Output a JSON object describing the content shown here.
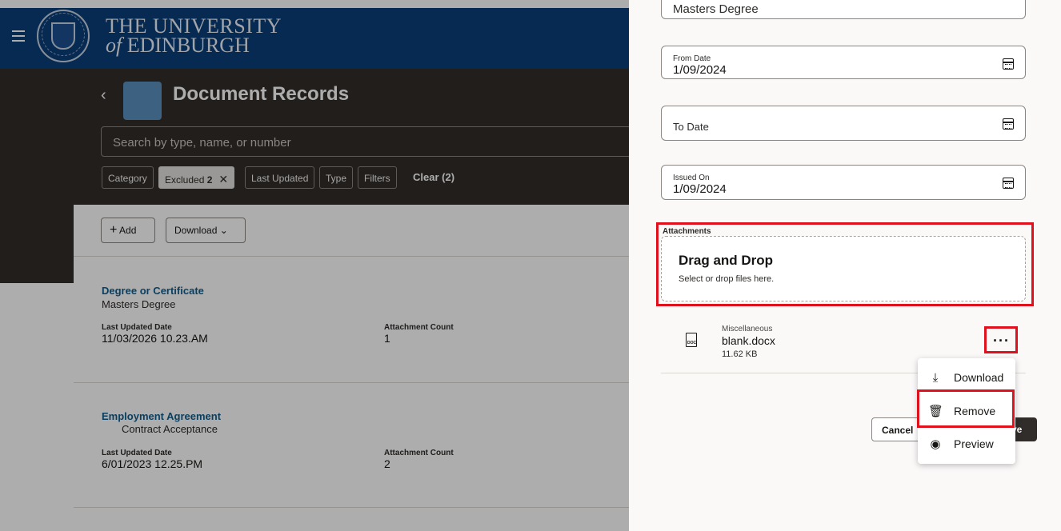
{
  "header": {
    "university_line1": "THE UNIVERSITY",
    "university_line2_prefix": "of",
    "university_line2": "EDINBURGH"
  },
  "page": {
    "title": "Document Records",
    "search_placeholder": "Search by type, name, or number",
    "filters": [
      {
        "label": "Category"
      },
      {
        "label": "Excluded",
        "count": "2",
        "selected": true
      },
      {
        "label": "Last Updated"
      },
      {
        "label": "Type"
      },
      {
        "label": "Filters"
      }
    ],
    "clear_label": "Clear (2)",
    "add_label": "Add",
    "download_label": "Download"
  },
  "records": [
    {
      "title": "Degree or Certificate",
      "subtitle": "Masters Degree",
      "updated_label": "Last Updated Date",
      "updated_value": "11/03/2026 10.23.AM",
      "count_label": "Attachment Count",
      "count_value": "1"
    },
    {
      "title": "Employment Agreement",
      "subtitle": "Contract Acceptance",
      "updated_label": "Last Updated Date",
      "updated_value": "6/01/2023 12.25.PM",
      "count_label": "Attachment Count",
      "count_value": "2"
    }
  ],
  "drawer": {
    "top_field_value": "Masters Degree",
    "from_date": {
      "label": "From Date",
      "value": "1/09/2024"
    },
    "to_date": {
      "label": "To Date",
      "value": ""
    },
    "issued_on": {
      "label": "Issued On",
      "value": "1/09/2024"
    },
    "attachments_label": "Attachments",
    "dropzone_title": "Drag and Drop",
    "dropzone_sub": "Select or drop files here.",
    "file": {
      "category": "Miscellaneous",
      "name": "blank.docx",
      "size": "11.62 KB",
      "icon_text": "DOC"
    },
    "kebab": "···",
    "cancel_label": "Cancel",
    "save_label_visible": "ve"
  },
  "context_menu": [
    {
      "label": "Download",
      "icon": "download-icon"
    },
    {
      "label": "Remove",
      "icon": "trash-icon"
    },
    {
      "label": "Preview",
      "icon": "eye-icon"
    }
  ],
  "colors": {
    "brand_blue": "#0a3f7a",
    "dark_band": "#312d2a",
    "highlight_red": "#e0101c",
    "link_teal": "#0f5e8f"
  }
}
